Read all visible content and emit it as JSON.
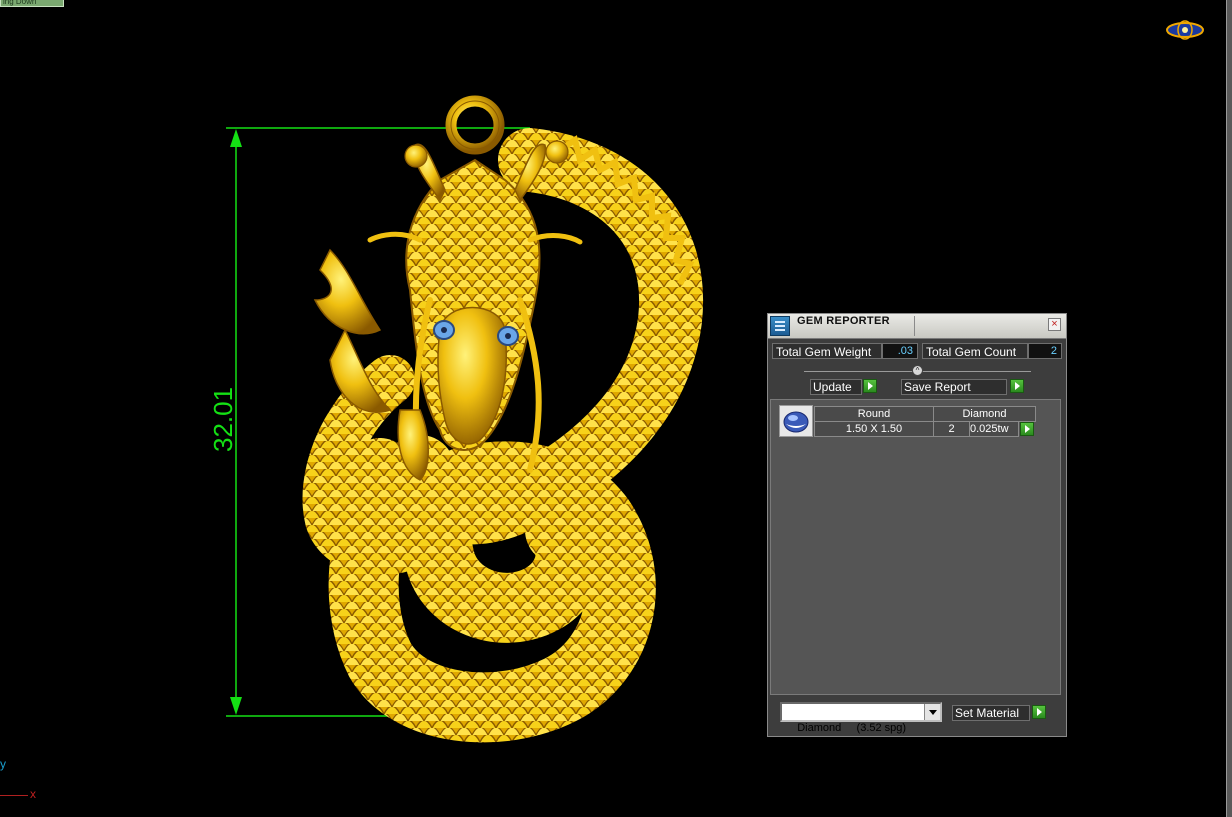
{
  "window": {
    "top_tab_label": "ing Down"
  },
  "viewport": {
    "dimension_value": "32.01",
    "axis_y_label": "y",
    "axis_x_label": "x",
    "colors": {
      "background": "#000000",
      "dimension_lines": "#14e014",
      "model": "#e6b000",
      "eyes": "#6aa6e8"
    }
  },
  "gem_reporter": {
    "title": "GEM REPORTER",
    "total_gem_weight_label": "Total Gem Weight",
    "total_gem_weight_value": ".03",
    "total_gem_count_label": "Total Gem Count",
    "total_gem_count_value": "2",
    "update_button": "Update",
    "save_report_button": "Save Report",
    "gem_rows": [
      {
        "shape": "Round",
        "material": "Diamond",
        "size": "1.50 X 1.50",
        "count": "2",
        "weight": "0.025tw"
      }
    ],
    "material_select_value": "Diamond     (3.52 spg)",
    "set_material_button": "Set Material",
    "colors": {
      "panel_bg": "#3d3d3d",
      "value_text": "#6ad0ff",
      "go_button": "#3aa82a"
    }
  }
}
